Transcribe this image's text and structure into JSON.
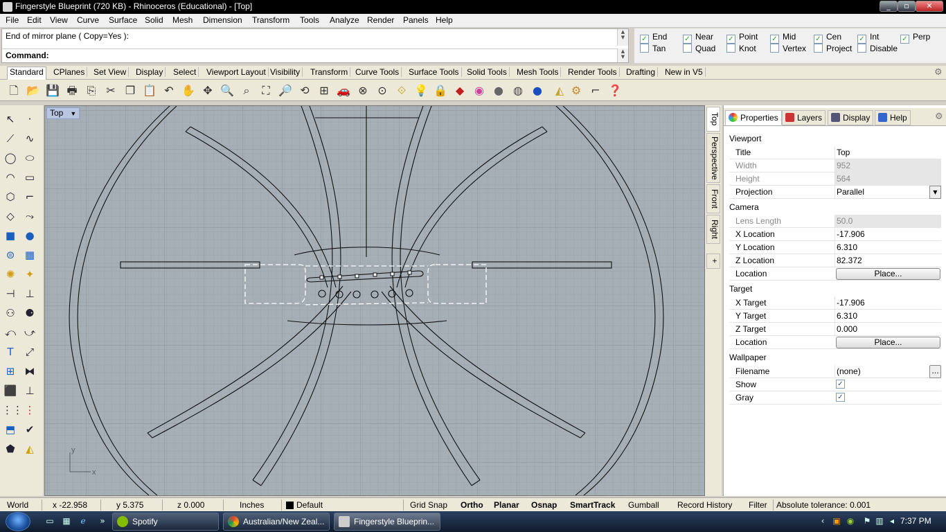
{
  "window": {
    "title": "Fingerstyle Blueprint (720 KB) - Rhinoceros (Educational) - [Top]",
    "minimize": "_",
    "maximize": "▫",
    "close": "✕"
  },
  "menu": [
    "File",
    "Edit",
    "View",
    "Curve",
    "Surface",
    "Solid",
    "Mesh",
    "Dimension",
    "Transform",
    "Tools",
    "Analyze",
    "Render",
    "Panels",
    "Help"
  ],
  "command": {
    "history": "End of mirror plane ( Copy=Yes ):",
    "label": "Command:",
    "value": ""
  },
  "osnap": [
    {
      "label": "End",
      "checked": true
    },
    {
      "label": "Near",
      "checked": true
    },
    {
      "label": "Point",
      "checked": true
    },
    {
      "label": "Mid",
      "checked": true
    },
    {
      "label": "Cen",
      "checked": true
    },
    {
      "label": "Int",
      "checked": true
    },
    {
      "label": "Perp",
      "checked": true
    },
    {
      "label": "Tan",
      "checked": false
    },
    {
      "label": "Quad",
      "checked": false
    },
    {
      "label": "Knot",
      "checked": false
    },
    {
      "label": "Vertex",
      "checked": false
    },
    {
      "label": "Project",
      "checked": false
    },
    {
      "label": "Disable",
      "checked": false
    }
  ],
  "toolbar_tabs": [
    "Standard",
    "CPlanes",
    "Set View",
    "Display",
    "Select",
    "Viewport Layout",
    "Visibility",
    "Transform",
    "Curve Tools",
    "Surface Tools",
    "Solid Tools",
    "Mesh Tools",
    "Render Tools",
    "Drafting",
    "New in V5"
  ],
  "viewport": {
    "label": "Top",
    "axis_y": "y",
    "axis_x": "x"
  },
  "viewport_tabs": [
    "Top",
    "Perspective",
    "Front",
    "Right",
    "+"
  ],
  "panel": {
    "tabs": [
      "Properties",
      "Layers",
      "Display",
      "Help"
    ],
    "sections": {
      "viewport": "Viewport",
      "camera": "Camera",
      "target": "Target",
      "wallpaper": "Wallpaper"
    },
    "rows": {
      "title": {
        "label": "Title",
        "value": "Top"
      },
      "width": {
        "label": "Width",
        "value": "952"
      },
      "height": {
        "label": "Height",
        "value": "564"
      },
      "projection": {
        "label": "Projection",
        "value": "Parallel"
      },
      "lens": {
        "label": "Lens Length",
        "value": "50.0"
      },
      "cam_x": {
        "label": "X Location",
        "value": "-17.906"
      },
      "cam_y": {
        "label": "Y Location",
        "value": "6.310"
      },
      "cam_z": {
        "label": "Z Location",
        "value": "82.372"
      },
      "cam_loc": {
        "label": "Location",
        "button": "Place..."
      },
      "tgt_x": {
        "label": "X Target",
        "value": "-17.906"
      },
      "tgt_y": {
        "label": "Y Target",
        "value": "6.310"
      },
      "tgt_z": {
        "label": "Z Target",
        "value": "0.000"
      },
      "tgt_loc": {
        "label": "Location",
        "button": "Place..."
      },
      "filename": {
        "label": "Filename",
        "value": "(none)",
        "button": "..."
      },
      "show": {
        "label": "Show",
        "checked": true
      },
      "gray": {
        "label": "Gray",
        "checked": true
      }
    }
  },
  "status": {
    "world": "World",
    "x": "x -22.958",
    "y": "y 5.375",
    "z": "z 0.000",
    "units": "Inches",
    "layer": "Default",
    "grid_snap": "Grid Snap",
    "ortho": "Ortho",
    "planar": "Planar",
    "osnap": "Osnap",
    "smarttrack": "SmartTrack",
    "gumball": "Gumball",
    "record_history": "Record History",
    "filter": "Filter",
    "tolerance": "Absolute tolerance: 0.001"
  },
  "taskbar": {
    "items": [
      "Spotify",
      "Australian/New Zeal...",
      "Fingerstyle Blueprin..."
    ],
    "clock": "7:37 PM"
  },
  "colors": {
    "viewport_bg": "#a6aeb6",
    "grid_minor": "#9ba3ab",
    "grid_major": "#8e969e",
    "curve": "#111111",
    "select_dash": "#ffffff",
    "accent_checkbox": "#21a121"
  }
}
